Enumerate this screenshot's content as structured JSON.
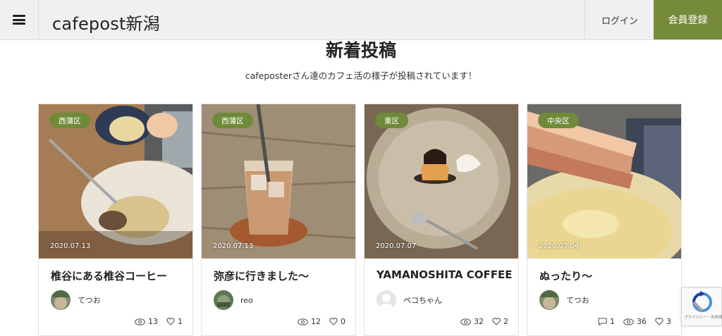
{
  "header": {
    "brand": "cafepost新潟",
    "login_label": "ログイン",
    "register_label": "会員登録"
  },
  "section": {
    "title": "新着投稿",
    "subtitle": "cafeposterさん達のカフェ活の様子が投稿されています！"
  },
  "posts": [
    {
      "tag": "西蒲区",
      "date": "2020.07.13",
      "title": "椎谷にある椎谷コーヒー",
      "author": "てつお",
      "views": "13",
      "likes": "1"
    },
    {
      "tag": "西蒲区",
      "date": "2020.07.13",
      "title": "弥彦に行きました〜",
      "author": "reo",
      "views": "12",
      "likes": "0"
    },
    {
      "tag": "東区",
      "date": "2020.07.07",
      "title": "YAMANOSHITA COFFEE",
      "author": "ペコちゃん",
      "views": "32",
      "likes": "2"
    },
    {
      "tag": "中央区",
      "date": "2020.07.04",
      "title": "ぬったり〜",
      "author": "てつお",
      "comments": "1",
      "views": "36",
      "likes": "3"
    }
  ],
  "recaptcha": {
    "footer_text": "プライバシー・利用規約"
  },
  "colors": {
    "accent": "#768b3a",
    "tag": "#6f8b3a"
  }
}
